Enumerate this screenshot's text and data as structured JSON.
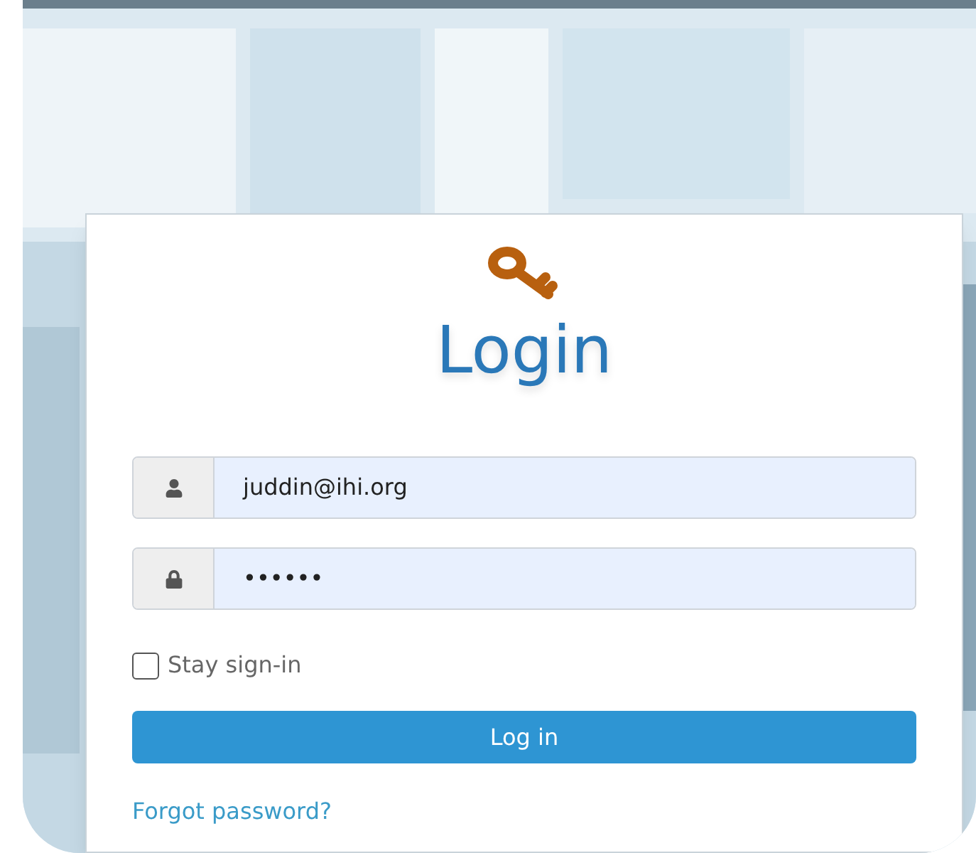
{
  "login": {
    "title": "Login",
    "fields": [
      {
        "kind": "user",
        "value": "juddin@ihi.org"
      },
      {
        "kind": "password",
        "value": "••••••"
      }
    ],
    "stay_signed_in": {
      "label": "Stay sign-in",
      "checked": false
    },
    "submit": "Log in",
    "forgot_link": "Forgot password?"
  }
}
